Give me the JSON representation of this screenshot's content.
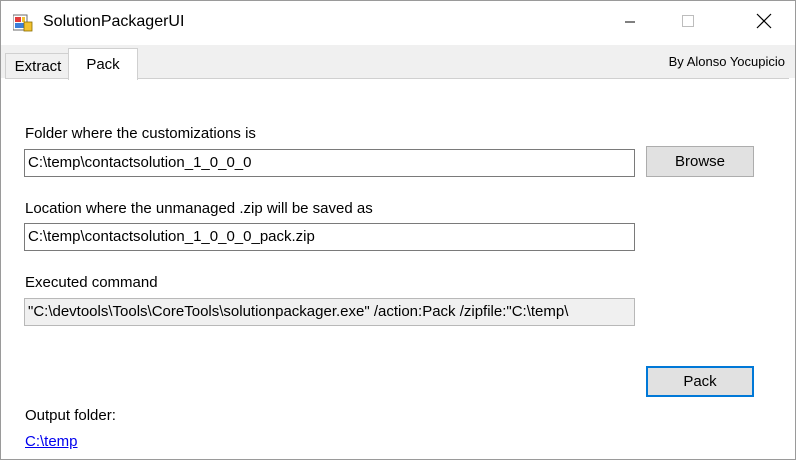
{
  "window": {
    "title": "SolutionPackagerUI"
  },
  "tabs": [
    {
      "label": "Extract",
      "selected": false
    },
    {
      "label": "Pack",
      "selected": true
    }
  ],
  "author": "By Alonso Yocupicio",
  "form": {
    "folder_label": "Folder where the customizations is",
    "folder_value": "C:\\temp\\contactsolution_1_0_0_0",
    "browse_label": "Browse",
    "location_label": "Location where the unmanaged .zip will be saved as",
    "location_value": "C:\\temp\\contactsolution_1_0_0_0_pack.zip",
    "command_label": "Executed command",
    "command_value": "\"C:\\devtools\\Tools\\CoreTools\\solutionpackager.exe\" /action:Pack /zipfile:\"C:\\temp\\",
    "pack_button_label": "Pack",
    "output_label": "Output folder:",
    "output_link": "C:\\temp"
  },
  "icons": {
    "app": "app-icon",
    "minimize": "minimize-icon",
    "maximize": "maximize-icon",
    "close": "close-icon"
  },
  "colors": {
    "accent": "#0078d7",
    "link": "#0000ee"
  }
}
